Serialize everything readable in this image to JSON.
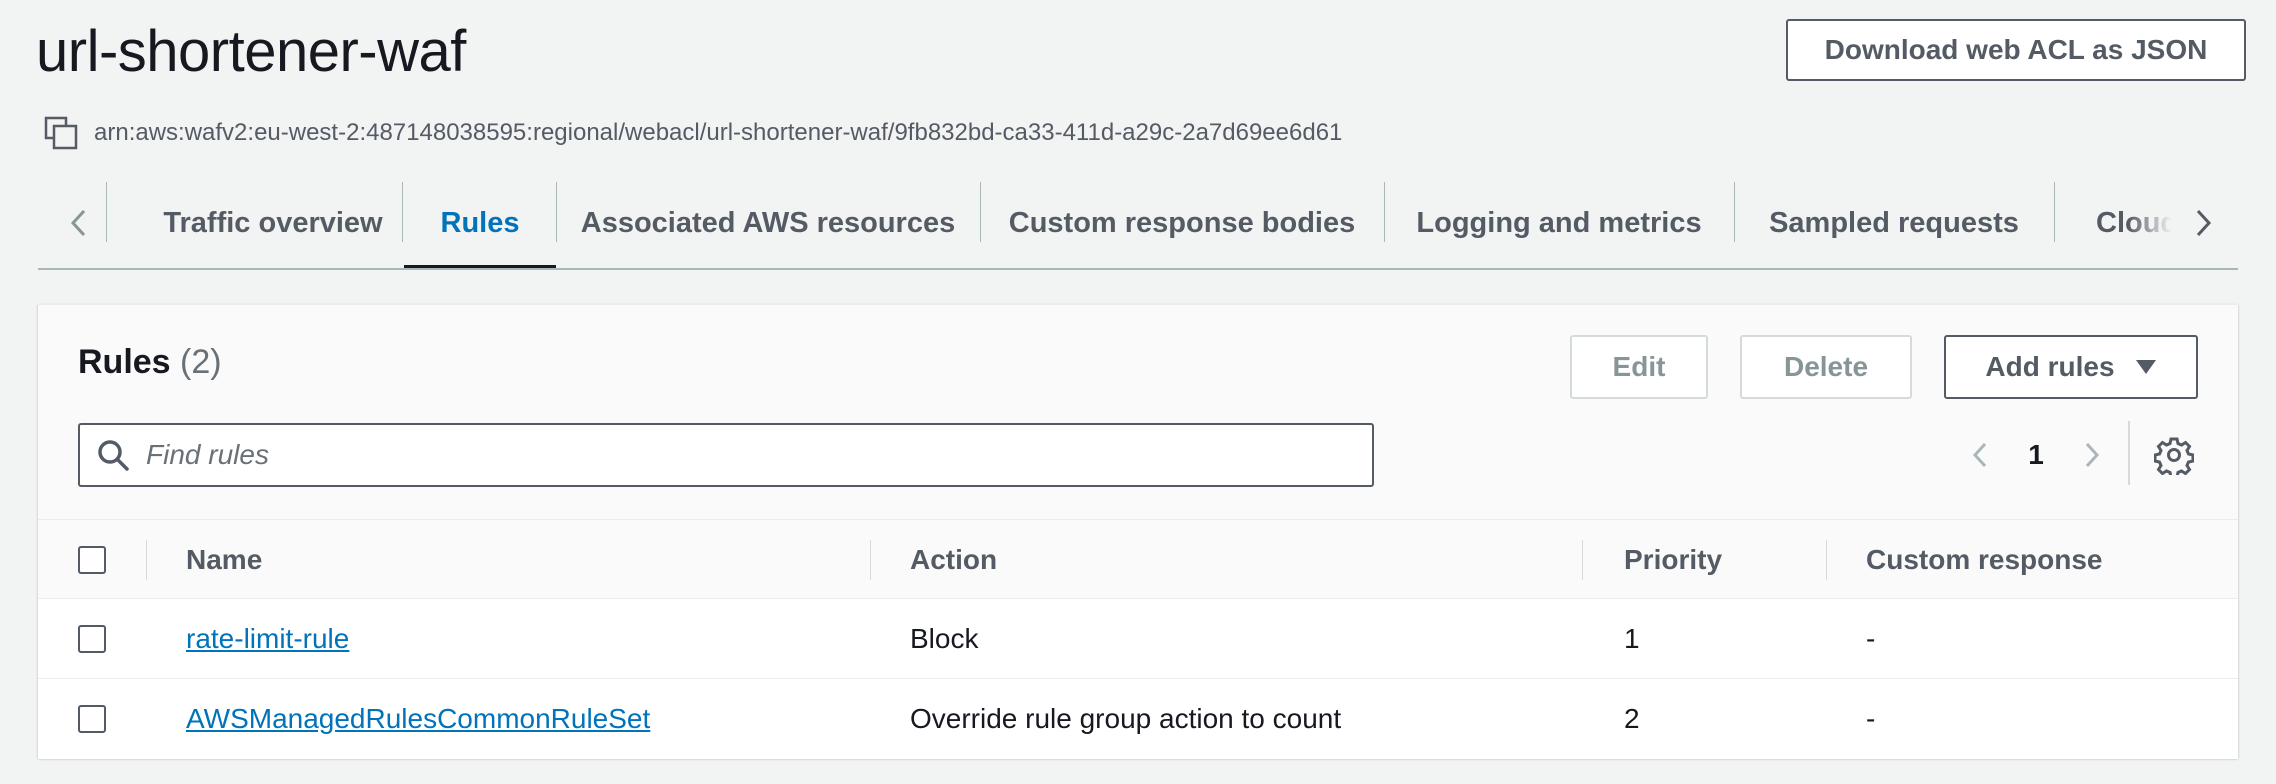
{
  "header": {
    "title": "url-shortener-waf",
    "download_label": "Download web ACL as JSON",
    "arn": "arn:aws:wafv2:eu-west-2:487148038595:regional/webacl/url-shortener-waf/9fb832bd-ca33-411d-a29c-2a7d69ee6d61"
  },
  "tabs": [
    {
      "label": "Traffic overview",
      "active": false
    },
    {
      "label": "Rules",
      "active": true
    },
    {
      "label": "Associated AWS resources",
      "active": false
    },
    {
      "label": "Custom response bodies",
      "active": false
    },
    {
      "label": "Logging and metrics",
      "active": false
    },
    {
      "label": "Sampled requests",
      "active": false
    },
    {
      "label": "Cloud",
      "active": false
    }
  ],
  "panel": {
    "title": "Rules",
    "count": "(2)",
    "edit_label": "Edit",
    "delete_label": "Delete",
    "add_label": "Add rules",
    "search_placeholder": "Find rules",
    "page": "1"
  },
  "table": {
    "columns": [
      "Name",
      "Action",
      "Priority",
      "Custom response"
    ],
    "rows": [
      {
        "name": "rate-limit-rule",
        "action": "Block",
        "priority": "1",
        "custom_response": "-"
      },
      {
        "name": "AWSManagedRulesCommonRuleSet",
        "action": "Override rule group action to count",
        "priority": "2",
        "custom_response": "-"
      }
    ]
  },
  "colors": {
    "link": "#0073bb",
    "active_tab": "#0073bb",
    "text_secondary": "#545b64",
    "background": "#f2f3f3"
  },
  "icons": [
    "copy-icon",
    "chevron-left-icon",
    "chevron-right-icon",
    "search-icon",
    "caret-down-icon",
    "settings-icon"
  ]
}
